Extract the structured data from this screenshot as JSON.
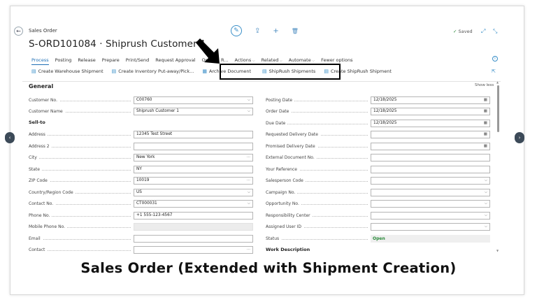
{
  "header": {
    "breadcrumb": "Sales Order",
    "title": "S-ORD101084 · Shiprush Customer 1",
    "saved_label": "Saved",
    "back_glyph": "←",
    "edit_glyph": "✎",
    "share_glyph": "⇪",
    "add_glyph": "+",
    "delete_glyph": "🗑",
    "saved_check": "✓",
    "expand_glyph": "⤢",
    "collapse_glyph": "⤡"
  },
  "menu": [
    {
      "label": "Process",
      "active": true
    },
    {
      "label": "Posting"
    },
    {
      "label": "Release"
    },
    {
      "label": "Prepare"
    },
    {
      "label": "Print/Send"
    },
    {
      "label": "Request Approval"
    },
    {
      "label": "Order"
    },
    {
      "label": "R..."
    },
    {
      "label": "Actions"
    },
    {
      "label": "Related"
    },
    {
      "label": "Automate"
    },
    {
      "label": "Fewer options"
    }
  ],
  "subactions": [
    {
      "label": "Create Warehouse Shipment",
      "icon": "▤"
    },
    {
      "label": "Create Inventory Put-away/Pick...",
      "icon": "▤"
    },
    {
      "label": "Archive Document",
      "icon": "▦"
    },
    {
      "label": "ShipRush Shipments",
      "icon": "▤"
    },
    {
      "label": "Create ShipRush Shipment",
      "icon": "▤"
    }
  ],
  "general": {
    "title": "General",
    "show_less": "Show less",
    "left": [
      {
        "label": "Customer No.",
        "value": "C00760",
        "suffix": "⌵"
      },
      {
        "label": "Customer Name",
        "value": "Shiprush Customer 1",
        "suffix": "⌵"
      },
      {
        "section": "Sell-to"
      },
      {
        "label": "Address",
        "value": "12345 Test Street"
      },
      {
        "label": "Address 2",
        "value": ""
      },
      {
        "label": "City",
        "value": "New York",
        "suffix": "···"
      },
      {
        "label": "State",
        "value": "NY"
      },
      {
        "label": "ZIP Code",
        "value": "10019",
        "suffix": "···"
      },
      {
        "label": "Country/Region Code",
        "value": "US",
        "suffix": "⌵"
      },
      {
        "label": "Contact No.",
        "value": "CT000031",
        "suffix": "⌵"
      },
      {
        "label": "Phone No.",
        "value": "+1 555-123-4567"
      },
      {
        "label": "Mobile Phone No.",
        "value": "",
        "disabled": true
      },
      {
        "label": "Email",
        "value": ""
      },
      {
        "label": "Contact",
        "value": "",
        "suffix": "···"
      }
    ],
    "right": [
      {
        "label": "Posting Date",
        "value": "12/18/2025",
        "suffix": "▦"
      },
      {
        "label": "Order Date",
        "value": "12/18/2025",
        "suffix": "▦"
      },
      {
        "label": "Due Date",
        "value": "12/18/2025",
        "suffix": "▦"
      },
      {
        "label": "Requested Delivery Date",
        "value": "",
        "suffix": "▦"
      },
      {
        "label": "Promised Delivery Date",
        "value": "",
        "suffix": "▦"
      },
      {
        "label": "External Document No.",
        "value": ""
      },
      {
        "label": "Your Reference",
        "value": ""
      },
      {
        "label": "Salesperson Code",
        "value": "",
        "suffix": "⌵"
      },
      {
        "label": "Campaign No.",
        "value": "",
        "suffix": "⌵"
      },
      {
        "label": "Opportunity No.",
        "value": "",
        "suffix": "⌵"
      },
      {
        "label": "Responsibility Center",
        "value": "",
        "suffix": "⌵"
      },
      {
        "label": "Assigned User ID",
        "value": "",
        "suffix": "⌵"
      },
      {
        "label": "Status",
        "value": "Open",
        "status": true
      },
      {
        "section": "Work Description"
      }
    ]
  },
  "caption": "Sales Order (Extended with Shipment Creation)",
  "colors": {
    "accent": "#1f6fb5",
    "status_open": "#2a8a3a",
    "highlight": "#000000"
  }
}
